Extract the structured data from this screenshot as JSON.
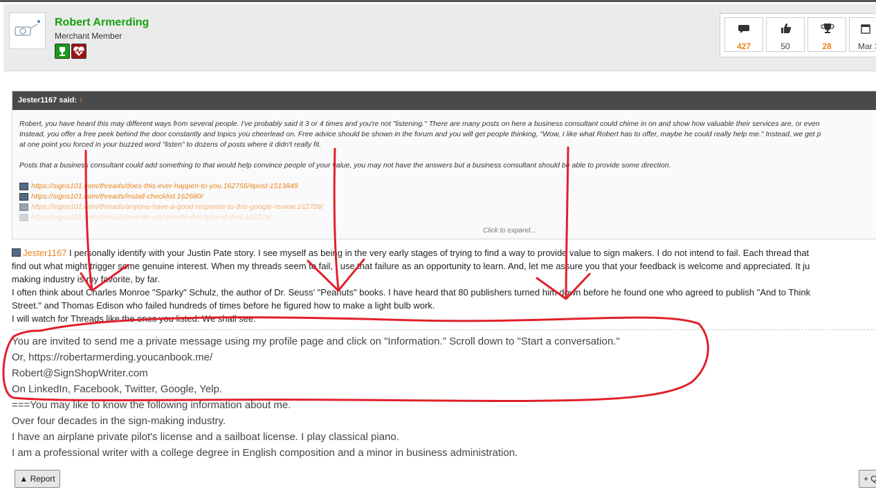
{
  "user": {
    "name": "Robert Armerding",
    "title": "Merchant Member"
  },
  "stats": [
    {
      "icon": "messages-icon",
      "value": "427"
    },
    {
      "icon": "thumbs-up-icon",
      "value": "50"
    },
    {
      "icon": "trophy-icon",
      "value": "28"
    },
    {
      "icon": "calendar-icon",
      "value": "Mar 3"
    }
  ],
  "quote": {
    "author": "Jester1167 said:",
    "arrow": "↑",
    "lines": [
      "Robert, you have heard this may different ways from several people. I've probably said it 3 or 4 times and you're not \"listening.\" There are many posts on here a business consultant could chime in on and show how valuable their services are, or even",
      "Instead, you offer a free peek behind the door constantly and topics you cheerlead on. Free advice should be shown in the forum and you will get people thinking, \"Wow, I like what Robert has to offer, maybe he could really help me.\" Instead, we get p",
      "at one point you forced in your buzzed word \"listen\" to dozens of posts where it didn't really fit.",
      "",
      "Posts that a business consultant could add something to that would help convince people of your value, you may not have the answers but a business consultant should be able to provide some direction."
    ],
    "links": [
      "https://signs101.com/threads/does-this-ever-happen-to-you.162756/#post-1513849",
      "https://signs101.com/threads/install-checklist.162680/",
      "https://signs101.com/threads/anyone-have-a-good-response-to-this-google-review.162708/",
      "https://signs101.com/threads/how-do-you-handle-this-type-of-deal.162723/"
    ],
    "expand": "Click to expand..."
  },
  "post": {
    "mention": "Jester1167",
    "line1": " I personally identify with your Justin Pate story. I see myself as being in the very early stages of trying to find a way to provide value to sign makers. I do not intend to fail. Each thread that",
    "lines": [
      "find out what might trigger some genuine interest. When my threads seem to fail, I use that failure as an opportunity to learn. And, let me assure you that your feedback is welcome and appreciated. It ju",
      "making industry is my favorite, by far.",
      "I often think about Charles Monroe \"Sparky\" Schulz, the author of Dr. Seuss' \"Peanuts\" books. I have heard that 80 publishers turned him down before he found one who agreed to publish \"And to Think",
      "Street.\" and Thomas Edison who failed hundreds of times before he figured how to make a light bulb work.",
      "I will watch for Threads like the ones you listed. We shall see."
    ]
  },
  "signature": [
    "You are invited to send me a private message using my profile page and click on \"Information.\" Scroll down to \"Start a conversation.\"",
    "Or, https://robertarmerding.youcanbook.me/",
    "Robert@SignShopWriter.com",
    "On LinkedIn, Facebook, Twitter, Google, Yelp.",
    "===You may like to know the following information about me.",
    "Over four decades in the sign-making industry.",
    "I have an airplane private pilot's license and a sailboat license. I play classical piano.",
    "I am a professional writer with a college degree in English composition and a minor in business administration."
  ],
  "actions": {
    "report": "Report",
    "quote": "+ Q"
  },
  "colors": {
    "username": "#13a20e",
    "accent": "#e8841c",
    "annotation": "#e0202a"
  }
}
